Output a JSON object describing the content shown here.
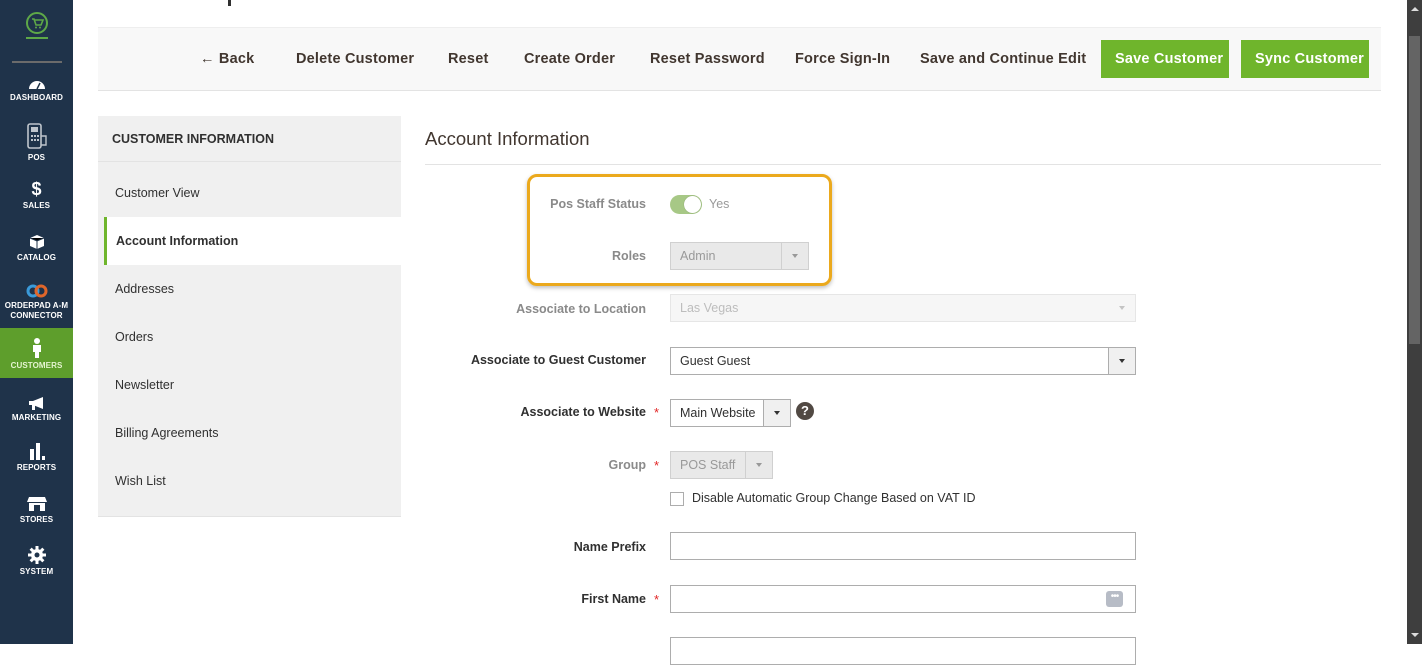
{
  "nav": {
    "items": [
      {
        "label": "DASHBOARD",
        "icon": "dashboard-gauge-icon"
      },
      {
        "label": "POS",
        "icon": "pos-terminal-icon"
      },
      {
        "label": "SALES",
        "icon": "dollar-icon"
      },
      {
        "label": "CATALOG",
        "icon": "box-icon"
      },
      {
        "label": "ORDERPAD A-M CONNECTOR",
        "label_line1": "ORDERPAD A-M",
        "label_line2": "CONNECTOR",
        "icon": "link-icon"
      },
      {
        "label": "CUSTOMERS",
        "icon": "person-icon",
        "active": true
      },
      {
        "label": "MARKETING",
        "icon": "megaphone-icon"
      },
      {
        "label": "REPORTS",
        "icon": "bar-chart-icon"
      },
      {
        "label": "STORES",
        "icon": "storefront-icon"
      },
      {
        "label": "SYSTEM",
        "icon": "gear-icon"
      }
    ]
  },
  "toolbar": {
    "back": "← Back",
    "delete": "Delete Customer",
    "reset": "Reset",
    "create_order": "Create Order",
    "reset_password": "Reset Password",
    "force_signin": "Force Sign-In",
    "save_continue": "Save and Continue Edit",
    "save": "Save Customer",
    "sync": "Sync Customer"
  },
  "tabs": {
    "heading": "CUSTOMER INFORMATION",
    "items": [
      {
        "label": "Customer View"
      },
      {
        "label": "Account Information",
        "active": true
      },
      {
        "label": "Addresses"
      },
      {
        "label": "Orders"
      },
      {
        "label": "Newsletter"
      },
      {
        "label": "Billing Agreements"
      },
      {
        "label": "Wish List"
      }
    ]
  },
  "form": {
    "section_title": "Account Information",
    "pos_staff_status": {
      "label": "Pos Staff Status",
      "value": "Yes",
      "enabled": true
    },
    "roles": {
      "label": "Roles",
      "value": "Admin"
    },
    "location": {
      "label": "Associate to Location",
      "value": "Las Vegas"
    },
    "guest_customer": {
      "label": "Associate to Guest Customer",
      "value": "Guest Guest"
    },
    "website": {
      "label": "Associate to Website",
      "value": "Main Website",
      "required": "*"
    },
    "group": {
      "label": "Group",
      "value": "POS Staff",
      "required": "*"
    },
    "disable_group_change": {
      "label": "Disable Automatic Group Change Based on VAT ID",
      "checked": false
    },
    "name_prefix": {
      "label": "Name Prefix",
      "value": ""
    },
    "first_name": {
      "label": "First Name",
      "value": "",
      "required": "*"
    },
    "help_glyph": "?",
    "dots_glyph": "•••"
  },
  "colors": {
    "accent": "#6fb52c",
    "nav_bg": "#1f334a",
    "highlight": "#eba91d",
    "required": "#e22626"
  }
}
